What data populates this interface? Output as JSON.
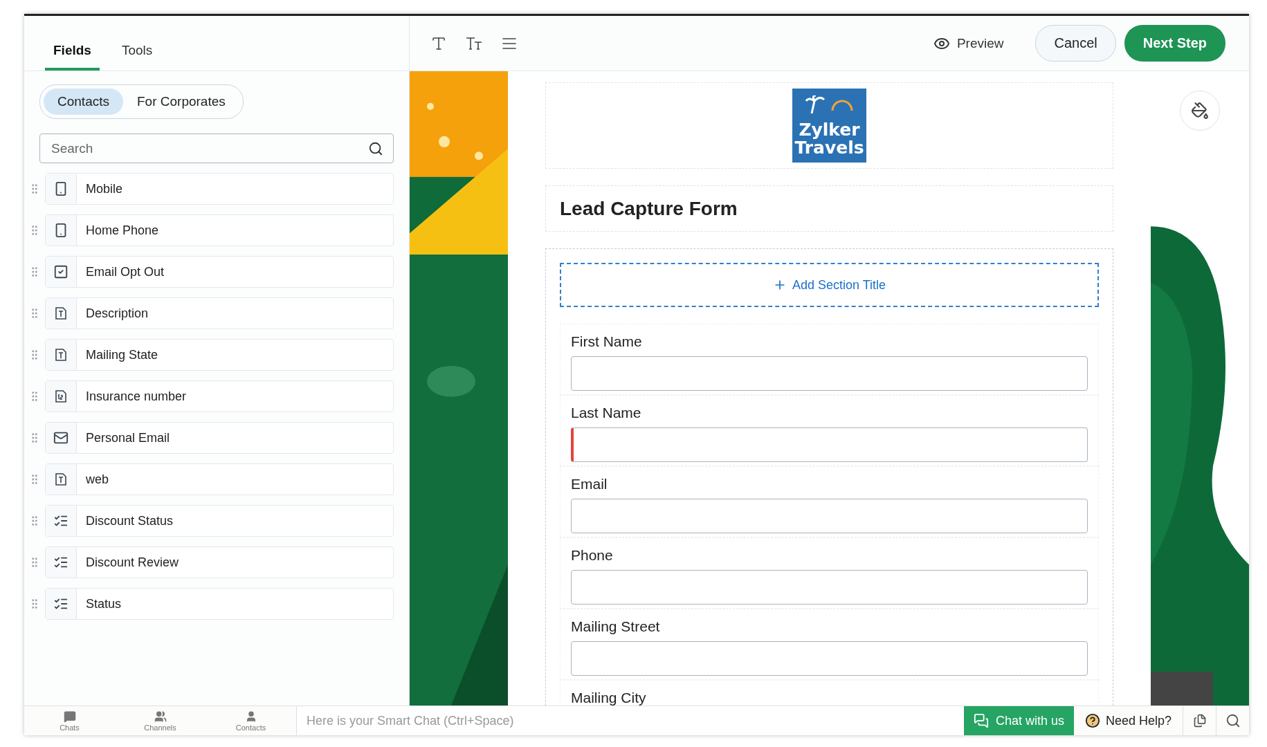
{
  "sidebar": {
    "tabs": [
      {
        "label": "Fields",
        "selected": true
      },
      {
        "label": "Tools",
        "selected": false
      }
    ],
    "segments": [
      {
        "label": "Contacts",
        "selected": true
      },
      {
        "label": "For Corporates",
        "selected": false
      }
    ],
    "search": {
      "placeholder": "Search"
    },
    "fields": [
      {
        "label": "Mobile",
        "kind": "phone"
      },
      {
        "label": "Home Phone",
        "kind": "phone"
      },
      {
        "label": "Email Opt Out",
        "kind": "checkbox"
      },
      {
        "label": "Description",
        "kind": "text"
      },
      {
        "label": "Mailing State",
        "kind": "text"
      },
      {
        "label": "Insurance number",
        "kind": "number"
      },
      {
        "label": "Personal Email",
        "kind": "email"
      },
      {
        "label": "web",
        "kind": "text"
      },
      {
        "label": "Discount Status",
        "kind": "picklist"
      },
      {
        "label": "Discount Review",
        "kind": "picklist"
      },
      {
        "label": "Status",
        "kind": "picklist"
      }
    ]
  },
  "toolbar": {
    "preview": "Preview",
    "cancel": "Cancel",
    "next": "Next Step"
  },
  "form": {
    "logo": {
      "line1": "Zylker",
      "line2": "Travels"
    },
    "title": "Lead Capture Form",
    "add_section": "Add Section Title",
    "fields": [
      {
        "label": "First Name",
        "invalid": false
      },
      {
        "label": "Last Name",
        "invalid": true
      },
      {
        "label": "Email",
        "invalid": false
      },
      {
        "label": "Phone",
        "invalid": false
      },
      {
        "label": "Mailing Street",
        "invalid": false
      },
      {
        "label": "Mailing City"
      }
    ]
  },
  "bottom_bar": {
    "tabs": [
      "Chats",
      "Channels",
      "Contacts"
    ],
    "smart_chat": {
      "placeholder": "Here is your Smart Chat (Ctrl+Space)"
    },
    "chat": "Chat with us",
    "help": "Need Help?"
  }
}
